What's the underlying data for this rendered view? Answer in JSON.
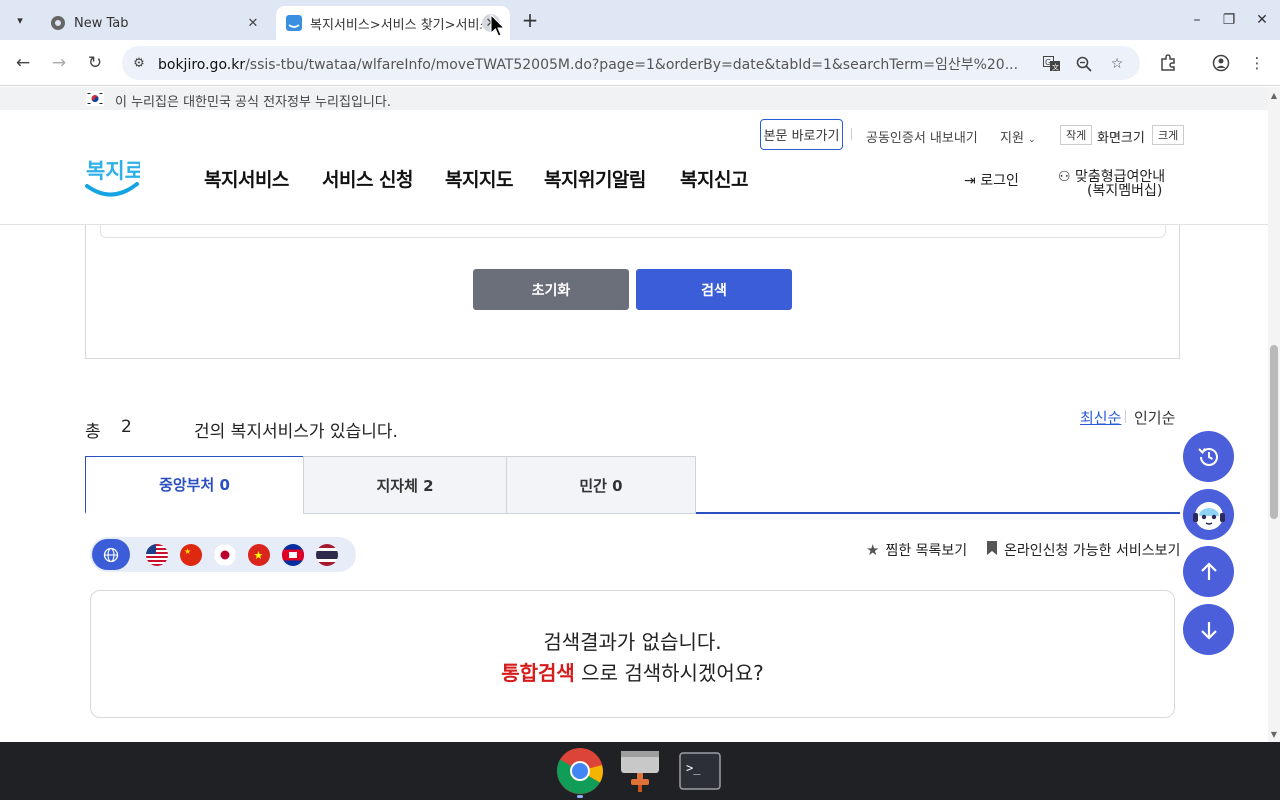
{
  "browser": {
    "tabs": [
      {
        "title": "New Tab",
        "active": false
      },
      {
        "title": "복지서비스>서비스 찾기>서비스 목록",
        "active": true
      }
    ],
    "url_host": "bokjiro.go.kr",
    "url_path": "/ssis-tbu/twataa/wlfareInfo/moveTWAT52005M.do?page=1&orderBy=date&tabId=1&searchTerm=임산부%20..."
  },
  "gov_banner": "이 누리집은 대한민국 공식 전자정부 누리집입니다.",
  "util": {
    "skip": "본문 바로가기",
    "cert": "공동인증서 내보내기",
    "support": "지원",
    "small": "작게",
    "screen_size": "화면크기",
    "large": "크게"
  },
  "header": {
    "logo_text": "복지로",
    "menu": [
      "복지서비스",
      "서비스 신청",
      "복지지도",
      "복지위기알림",
      "복지신고"
    ],
    "login": "로그인",
    "custom_line1": "맞춤형급여안내",
    "custom_line2": "(복지멤버십)"
  },
  "search": {
    "reset": "초기화",
    "submit": "검색"
  },
  "results": {
    "prefix": "총",
    "count": "2",
    "suffix": "건의 복지서비스가 있습니다.",
    "sort_latest": "최신순",
    "sort_popular": "인기순",
    "tabs": [
      {
        "label": "중앙부처 0",
        "active": true
      },
      {
        "label": "지자체 2",
        "active": false
      },
      {
        "label": "민간 0",
        "active": false
      }
    ],
    "favorites": "찜한 목록보기",
    "online": "온라인신청 가능한 서비스보기",
    "empty_line1": "검색결과가 없습니다.",
    "empty_link": "통합검색",
    "empty_line2": " 으로 검색하시겠어요?"
  },
  "colors": {
    "primary": "#3b5ed8",
    "accent_red": "#d51b1b",
    "fab": "#4a5fd9"
  }
}
